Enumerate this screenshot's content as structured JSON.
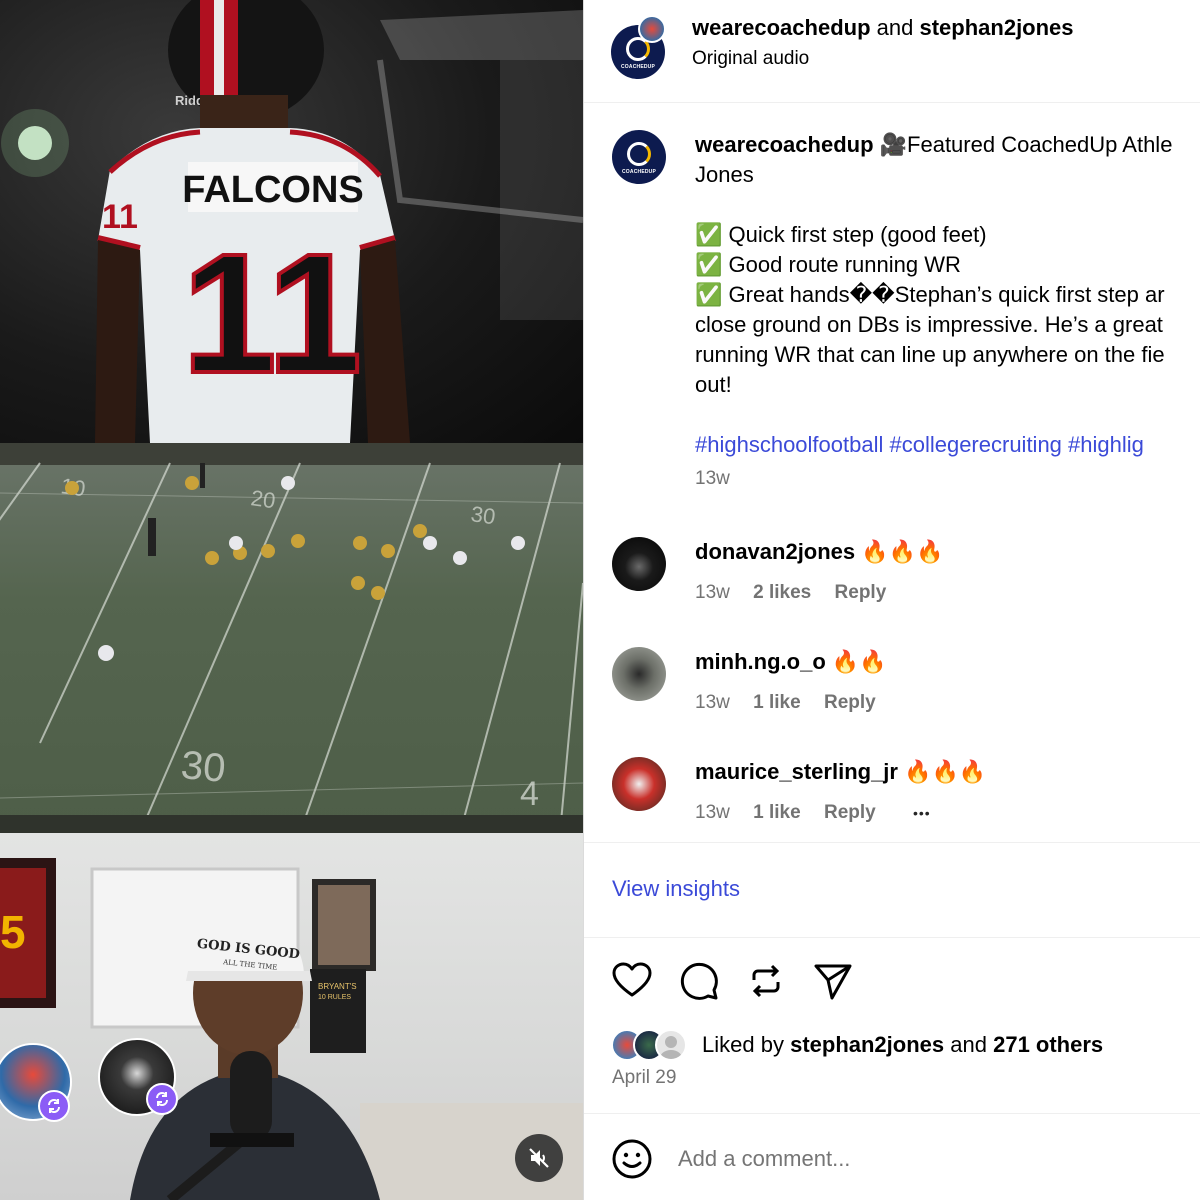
{
  "header": {
    "user1": "wearecoachedup",
    "and": "and",
    "user2": "stephan2jones",
    "audio": "Original audio"
  },
  "caption": {
    "user": "wearecoachedup",
    "line1": "🎥Featured CoachedUp Athle",
    "line2": "Jones",
    "check1": "Quick first step (good feet)",
    "check2": "Good route running WR",
    "check3": "Great hands��Stephan’s quick first step ar",
    "line6": "close ground on DBs is impressive. He’s a great",
    "line7": "running WR that can line up anywhere on the fie",
    "line8": "out!",
    "hashtags": "#highschoolfootball #collegerecruiting #highlig",
    "time": "13w"
  },
  "comments": [
    {
      "user": "donavan2jones",
      "emoji": "🔥🔥🔥",
      "time": "13w",
      "likes": "2 likes",
      "reply": "Reply"
    },
    {
      "user": "minh.ng.o_o",
      "emoji": "🔥🔥",
      "time": "13w",
      "likes": "1 like",
      "reply": "Reply"
    },
    {
      "user": "maurice_sterling_jr",
      "emoji": "🔥🔥🔥",
      "time": "13w",
      "likes": "1 like",
      "reply": "Reply",
      "more": "•••"
    }
  ],
  "insights": "View insights",
  "likes": {
    "prefix": "Liked by",
    "user": "stephan2jones",
    "and": "and",
    "others": "271 others"
  },
  "date": "April 29",
  "comment_input": {
    "placeholder": "Add a comment..."
  },
  "media": {
    "jersey_name": "FALCONS",
    "jersey_number": "11",
    "helmet_brand": "Riddell",
    "yard_30": "30",
    "yard_40": "4",
    "hat_line1": "GOD IS GOOD",
    "hat_line2": "ALL THE TIME",
    "poster_title": "BRYANT'S",
    "poster_sub": "10 RULES"
  },
  "colors": {
    "link": "#3b4ad8",
    "meta": "#737373",
    "check": "#2e9e3e",
    "badge": "#8b5cf6",
    "jersey_red": "#b01020"
  }
}
